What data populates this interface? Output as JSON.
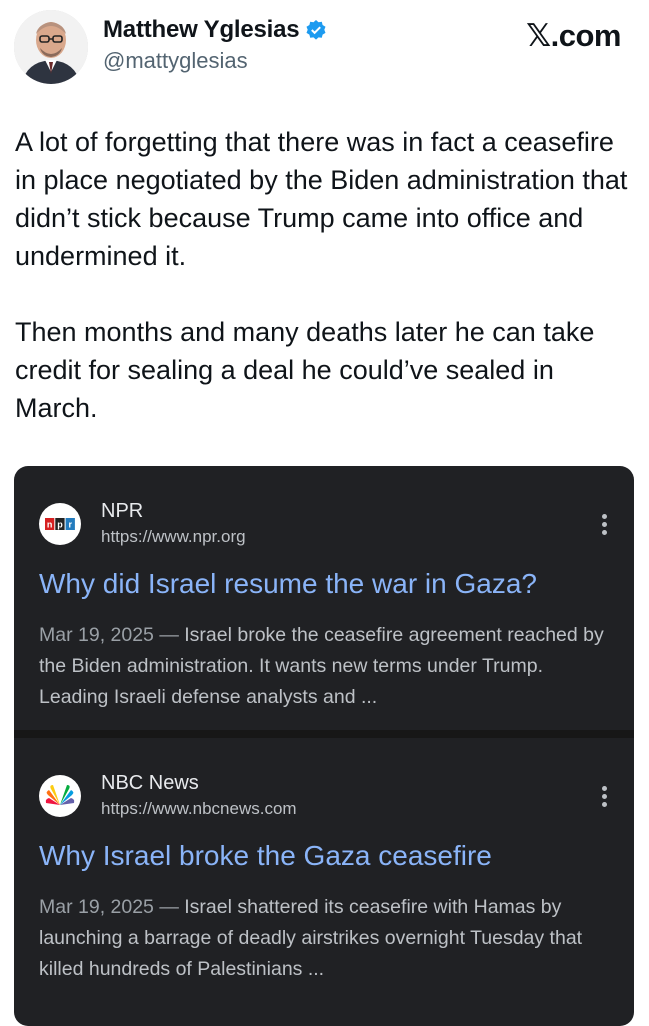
{
  "author": {
    "display_name": "Matthew Yglesias",
    "handle": "@mattyglesias",
    "verified": true
  },
  "brand": "𝕏.com",
  "tweet": {
    "paragraphs": [
      "A lot of forgetting that there was in fact a ceasefire in place negotiated by the Biden administration that didn’t stick because Trump came into office and undermined it.",
      "Then months and many deaths later he can take credit for sealing a deal he could’ve sealed in March."
    ]
  },
  "results": [
    {
      "source": "NPR",
      "url": "https://www.npr.org",
      "favicon": "npr-logo-icon",
      "title": "Why did Israel resume the war in Gaza?",
      "date": "Mar 19, 2025",
      "separator": " — ",
      "snippet": "Israel broke the ceasefire agreement reached by the Biden administration. It wants new terms under Trump. Leading Israeli defense analysts and ..."
    },
    {
      "source": "NBC News",
      "url": "https://www.nbcnews.com",
      "favicon": "nbc-peacock-icon",
      "title": "Why Israel broke the Gaza ceasefire",
      "date": "Mar 19, 2025",
      "separator": " — ",
      "snippet": "Israel shattered its ceasefire with Hamas by launching a barrage of deadly airstrikes overnight Tuesday that killed hundreds of Palestinians ..."
    }
  ],
  "colors": {
    "link_blue": "#8ab4f8",
    "card_bg": "#202124",
    "verified_blue": "#1d9bf0"
  }
}
